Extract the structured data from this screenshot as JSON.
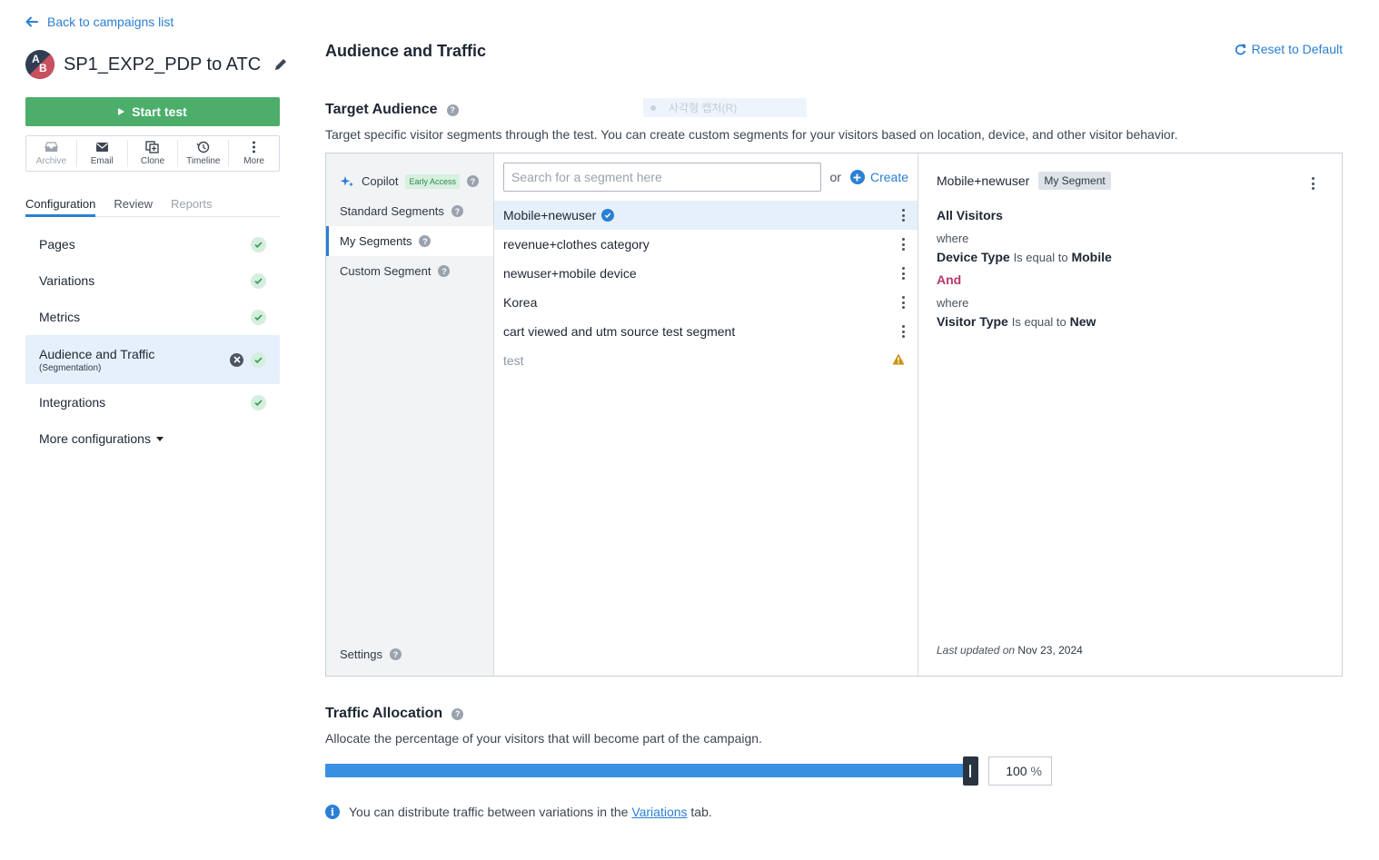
{
  "nav_back": {
    "label": "Back to campaigns list"
  },
  "campaign": {
    "avatar_a": "A",
    "avatar_b": "B",
    "title": "SP1_EXP2_PDP to ATC"
  },
  "start_button": {
    "label": "Start test"
  },
  "actions": [
    {
      "label": "Archive",
      "icon": "archive-icon",
      "enabled": false
    },
    {
      "label": "Email",
      "icon": "email-icon",
      "enabled": true
    },
    {
      "label": "Clone",
      "icon": "clone-icon",
      "enabled": true
    },
    {
      "label": "Timeline",
      "icon": "timeline-icon",
      "enabled": true
    },
    {
      "label": "More",
      "icon": "more-icon",
      "enabled": true
    }
  ],
  "tabs": [
    {
      "label": "Configuration",
      "active": true
    },
    {
      "label": "Review",
      "active": false
    },
    {
      "label": "Reports",
      "active": false,
      "disabled": true
    }
  ],
  "config_nav": [
    {
      "label": "Pages",
      "status": "complete"
    },
    {
      "label": "Variations",
      "status": "complete"
    },
    {
      "label": "Metrics",
      "status": "complete"
    },
    {
      "label": "Audience and Traffic",
      "sublabel": "(Segmentation)",
      "status": "complete",
      "active": true
    },
    {
      "label": "Integrations",
      "status": "complete"
    },
    {
      "label": "More configurations"
    }
  ],
  "main": {
    "title": "Audience and Traffic",
    "reset_label": "Reset to Default",
    "ghost_text": "사각형 캡처(R)"
  },
  "target_audience": {
    "title": "Target Audience",
    "description": "Target specific visitor segments through the test. You can create custom segments for your visitors based on location, device, and other visitor behavior.",
    "nav": {
      "copilot": "Copilot",
      "early_access": "Early Access",
      "standard": "Standard Segments",
      "my": "My Segments",
      "custom": "Custom Segment",
      "settings": "Settings"
    },
    "search_placeholder": "Search for a segment here",
    "or_text": "or",
    "create_label": "Create",
    "segments": [
      {
        "name": "Mobile+newuser",
        "selected": true,
        "verified": true
      },
      {
        "name": "revenue+clothes category"
      },
      {
        "name": "newuser+mobile device"
      },
      {
        "name": "Korea"
      },
      {
        "name": "cart viewed and utm source test segment"
      },
      {
        "name": "test",
        "muted": true,
        "warning": true
      }
    ],
    "detail": {
      "name": "Mobile+newuser",
      "tag": "My Segment",
      "audience": "All Visitors",
      "where1": "where",
      "cond1_field": "Device Type",
      "cond1_op": "Is equal to",
      "cond1_value": "Mobile",
      "and_label": "And",
      "where2": "where",
      "cond2_field": "Visitor Type",
      "cond2_op": "Is equal to",
      "cond2_value": "New",
      "updated_prefix": "Last updated on",
      "updated_date": "Nov 23, 2024"
    }
  },
  "traffic": {
    "title": "Traffic Allocation",
    "description": "Allocate the percentage of your visitors that will become part of the campaign.",
    "percent": "100",
    "percent_value": 100,
    "unit": "%",
    "note_prefix": "You can distribute traffic between variations in the",
    "note_link": "Variations",
    "note_suffix": "tab."
  },
  "colors": {
    "accent": "#2b7fd4",
    "start_green": "#4cae6a",
    "and_pink": "#b7396b"
  }
}
